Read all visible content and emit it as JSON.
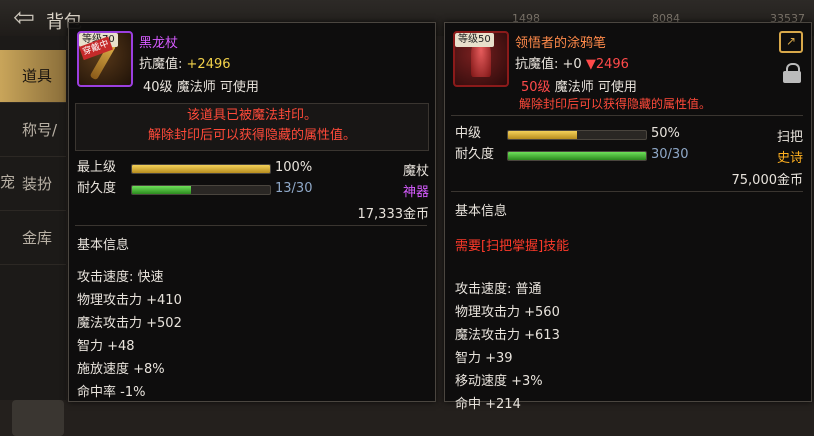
{
  "header": {
    "title": "背包",
    "back": "⇦",
    "nums": [
      "1498",
      "8084",
      "33537"
    ]
  },
  "sidebar": {
    "tabs": [
      {
        "label": "道具"
      },
      {
        "label": "称号/宠"
      },
      {
        "label": "装扮"
      },
      {
        "label": "金库"
      }
    ]
  },
  "left_item": {
    "level_badge": "等级70",
    "tag": "穿戴中",
    "name": "黑龙杖",
    "magic_res_label": "抗魔值:",
    "magic_res_value": "+2496",
    "req_level": "40级",
    "req_class": "魔法师 可使用",
    "seal_line1": "该道具已被魔法封印。",
    "seal_line2": "解除封印后可以获得隐藏的属性值。",
    "grade_label": "最上级",
    "grade_percent": "100%",
    "grade_fill": 1.0,
    "durability_label": "耐久度",
    "durability_value": "13/30",
    "durability_fill": 0.43,
    "weapon_type": "魔杖",
    "rarity": "神器",
    "price": "17,333金币",
    "basic_info_title": "基本信息",
    "attributes": [
      "攻击速度:  快速",
      "物理攻击力 +410",
      "魔法攻击力 +502",
      "智力 +48",
      "施放速度 +8%",
      "命中率 -1%"
    ]
  },
  "right_item": {
    "level_badge": "等级50",
    "name": "领悟者的涂鸦笔",
    "magic_res_label": "抗魔值:",
    "magic_res_value": "+0",
    "magic_res_diff": "▼2496",
    "req_level": "50级",
    "req_class": "魔法师 可使用",
    "unseal_line": "解除封印后可以获得隐藏的属性值。",
    "grade_label": "中级",
    "grade_percent": "50%",
    "grade_fill": 0.5,
    "durability_label": "耐久度",
    "durability_value": "30/30",
    "durability_fill": 1.0,
    "weapon_type": "扫把",
    "rarity": "史诗",
    "price": "75,000金币",
    "basic_info_title": "基本信息",
    "skill_requirement": "需要[扫把掌握]技能",
    "attributes": [
      "攻击速度:  普通",
      "物理攻击力 +560",
      "魔法攻击力 +613",
      "智力 +39",
      "移动速度 +3%",
      "命中 +214"
    ]
  },
  "colors": {
    "epic_name": "#d65bff",
    "legend_name": "#ff8a4a",
    "rarity_artifact": "#d65bff",
    "rarity_epic": "#ffb020",
    "warning_red": "#ff4a3a"
  },
  "icons": {
    "back": "back-arrow-icon",
    "share": "share-icon",
    "lock": "lock-icon"
  }
}
